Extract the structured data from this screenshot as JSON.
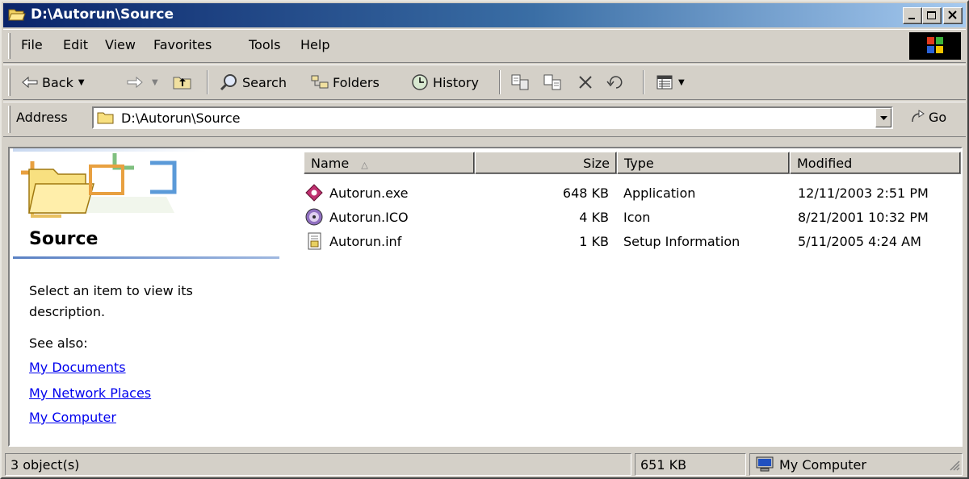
{
  "window": {
    "title": "D:\\Autorun\\Source"
  },
  "menu": [
    "File",
    "Edit",
    "View",
    "Favorites",
    "Tools",
    "Help"
  ],
  "toolbar": {
    "back_label": "Back",
    "search_label": "Search",
    "folders_label": "Folders",
    "history_label": "History"
  },
  "address": {
    "label": "Address",
    "value": "D:\\Autorun\\Source",
    "go_label": "Go"
  },
  "left_pane": {
    "folder_name": "Source",
    "description": "Select an item to view its description.",
    "see_also_label": "See also:",
    "links": [
      "My Documents",
      "My Network Places",
      "My Computer"
    ]
  },
  "file_list": {
    "columns": [
      "Name",
      "Size",
      "Type",
      "Modified"
    ],
    "rows": [
      {
        "name": "Autorun.exe",
        "size": "648 KB",
        "type": "Application",
        "modified": "12/11/2003 2:51 PM",
        "icon": "application-icon"
      },
      {
        "name": "Autorun.ICO",
        "size": "4 KB",
        "type": "Icon",
        "modified": "8/21/2001 10:32 PM",
        "icon": "cd-icon"
      },
      {
        "name": "Autorun.inf",
        "size": "1 KB",
        "type": "Setup Information",
        "modified": "5/11/2005 4:24 AM",
        "icon": "setup-file-icon"
      }
    ]
  },
  "status": {
    "objects": "3 object(s)",
    "size": "651 KB",
    "zone": "My Computer"
  },
  "colors": {
    "title_active": "#0a246a",
    "face": "#d4d0c8",
    "link": "#0000ee"
  }
}
